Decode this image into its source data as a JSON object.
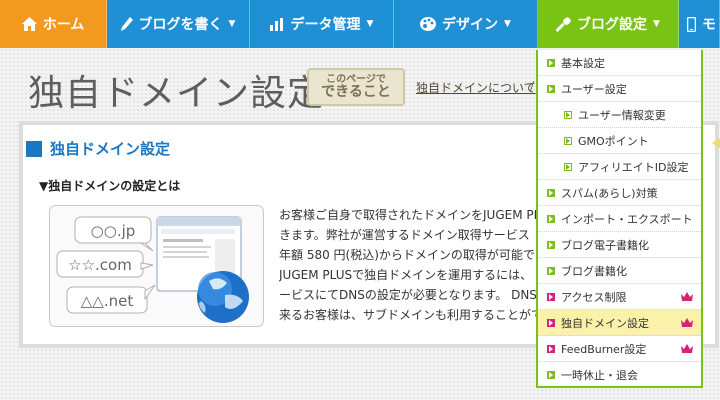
{
  "nav": {
    "home": "ホーム",
    "write": "ブログを書く",
    "data": "データ管理",
    "design": "デザイン",
    "settings": "ブログ設定",
    "mobile": "モ"
  },
  "page": {
    "title": "独自ドメイン設定",
    "can_do_line1": "このページで",
    "can_do_line2": "できること",
    "breadcrumb": "独自ドメインについて",
    "breadcrumb_sep": "/"
  },
  "section": {
    "title": "独自ドメイン設定",
    "subtitle": "▼独自ドメインの設定とは",
    "illustration": {
      "domains": [
        "○○.jp",
        "☆☆.com",
        "△△.net"
      ]
    },
    "body_lines": [
      "お客様ご自身で取得されたドメインをJUGEM PL",
      "きます。弊社が運営するドメイン取得サービス",
      "年額 580 円(税込)からドメインの取得が可能で",
      "JUGEM PLUSで独自ドメインを運用するには、",
      "ービスにてDNSの設定が必要となります。 DNS",
      "来るお客様は、サブドメインも利用することがで"
    ]
  },
  "dropdown": {
    "items": [
      {
        "label": "基本設定"
      },
      {
        "label": "ユーザー設定"
      },
      {
        "label": "ユーザー情報変更"
      },
      {
        "label": "GMOポイント"
      },
      {
        "label": "アフィリエイトID設定"
      },
      {
        "label": "スパム(あらし)対策"
      },
      {
        "label": "インポート・エクスポート"
      },
      {
        "label": "ブログ電子書籍化"
      },
      {
        "label": "ブログ書籍化"
      },
      {
        "label": "アクセス制限"
      },
      {
        "label": "独自ドメイン設定"
      },
      {
        "label": "FeedBurner設定"
      },
      {
        "label": "一時休止・退会"
      }
    ]
  },
  "colors": {
    "home_tab": "#f39a1e",
    "blue_tab": "#1f8fd6",
    "settings_tab": "#78c314",
    "section_blue": "#1a78c2",
    "premium_pink": "#d6237a",
    "active_row": "#fbf1a8"
  },
  "icons": {
    "home": "house-icon",
    "write": "pencil-icon",
    "data": "bar-chart-icon",
    "design": "palette-icon",
    "settings": "wrench-icon",
    "mobile": "phone-icon",
    "premium": "crown-icon"
  }
}
